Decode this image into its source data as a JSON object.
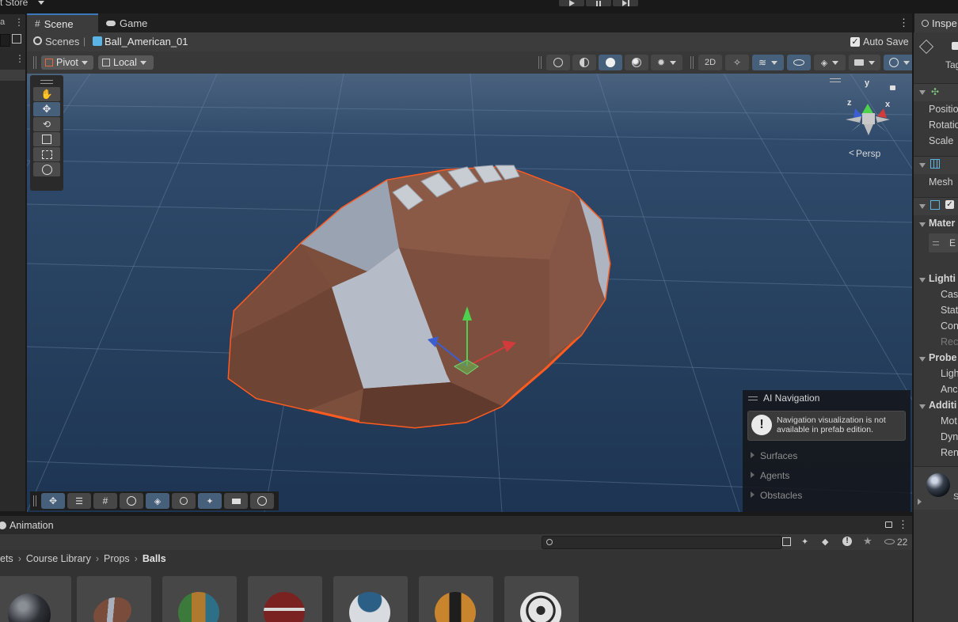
{
  "topbar": {
    "asset_store_label": "t Store",
    "play_icons": [
      "play-icon",
      "pause-icon",
      "step-icon"
    ]
  },
  "scene_tabs": {
    "scene_label": "Scene",
    "game_label": "Game"
  },
  "breadcrumb": {
    "scenes_label": "Scenes",
    "prefab_label": "Ball_American_01",
    "auto_save_label": "Auto Save",
    "auto_save_checked": true
  },
  "toolbar": {
    "pivot_label": "Pivot",
    "local_label": "Local"
  },
  "gizmo": {
    "x_label": "x",
    "y_label": "y",
    "z_label": "z",
    "persp_label": "Persp"
  },
  "ai_navigation": {
    "title": "AI Navigation",
    "message": "Navigation visualization is not available in prefab edition.",
    "items": [
      "Surfaces",
      "Agents",
      "Obstacles"
    ]
  },
  "animation": {
    "tab_label": "Animation"
  },
  "project": {
    "search_placeholder": "",
    "visible_count": "22",
    "path": [
      "ets",
      "Course Library",
      "Props",
      "Balls"
    ],
    "thumbnails": [
      "black-ball",
      "american-football",
      "striped-ball",
      "red-ball",
      "white-blue-ball",
      "orange-black-ball",
      "soccer-ball"
    ]
  },
  "inspector": {
    "tab_label": "Inspe",
    "tag_label": "Tag",
    "transform_rows": [
      "Positio",
      "Rotatio",
      "Scale"
    ],
    "mesh_label": "Mesh",
    "materials_label": "Mater",
    "material_item": "E",
    "lighting_label": "Lighti",
    "lighting_rows": [
      "Cas",
      "Stat",
      "Con",
      "Rec"
    ],
    "probes_label": "Probe",
    "probes_rows": [
      "Ligh",
      "Anc"
    ],
    "additional_label": "Additi",
    "additional_rows": [
      "Mot",
      "Dyn",
      "Ren"
    ],
    "preview_label": "S"
  },
  "colors": {
    "accent": "#46607c",
    "selection_outline": "#ff5a1f",
    "sky": "#2a4566",
    "ball_brown": "#8a5a45",
    "ball_white": "#a9b0bd"
  }
}
